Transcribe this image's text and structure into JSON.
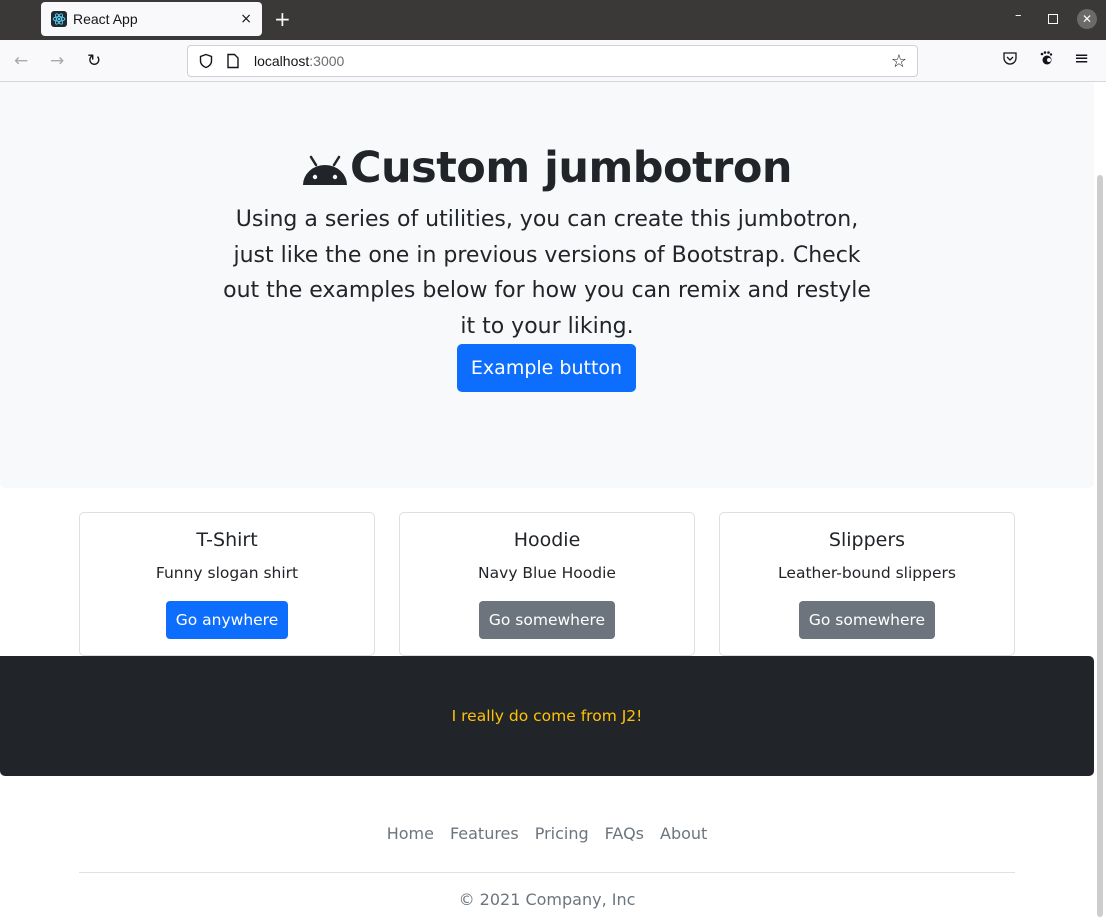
{
  "browser": {
    "tab": {
      "title": "React App",
      "favicon": "react-logo-icon",
      "close_icon": "×"
    },
    "new_tab_icon": "+",
    "window_controls": {
      "minimize": "–",
      "close": "✕"
    },
    "nav": {
      "back_icon": "←",
      "forward_icon": "→",
      "reload_icon": "↻"
    },
    "url": {
      "host": "localhost",
      "port": ":3000"
    },
    "bookmark_icon": "☆",
    "menu_icon": "≡"
  },
  "jumbotron": {
    "icon": "android-icon",
    "title": "Custom jumbotron",
    "text": "Using a series of utilities, you can create this jumbotron, just like the one in previous versions of Bootstrap. Check out the examples below for how you can remix and restyle it to your liking.",
    "button_label": "Example button",
    "button_color": "#0d6efd",
    "background": "#f8f9fa"
  },
  "cards": [
    {
      "title": "T-Shirt",
      "text": "Funny slogan shirt",
      "button_label": "Go anywhere",
      "button_variant": "primary"
    },
    {
      "title": "Hoodie",
      "text": "Navy Blue Hoodie",
      "button_label": "Go somewhere",
      "button_variant": "secondary"
    },
    {
      "title": "Slippers",
      "text": "Leather-bound slippers",
      "button_label": "Go somewhere",
      "button_variant": "secondary"
    }
  ],
  "dark_band": {
    "text": "I really do come from J2!",
    "text_color": "#ffc107",
    "background": "#212529"
  },
  "footer": {
    "links": [
      "Home",
      "Features",
      "Pricing",
      "FAQs",
      "About"
    ],
    "copyright": "© 2021 Company, Inc"
  }
}
